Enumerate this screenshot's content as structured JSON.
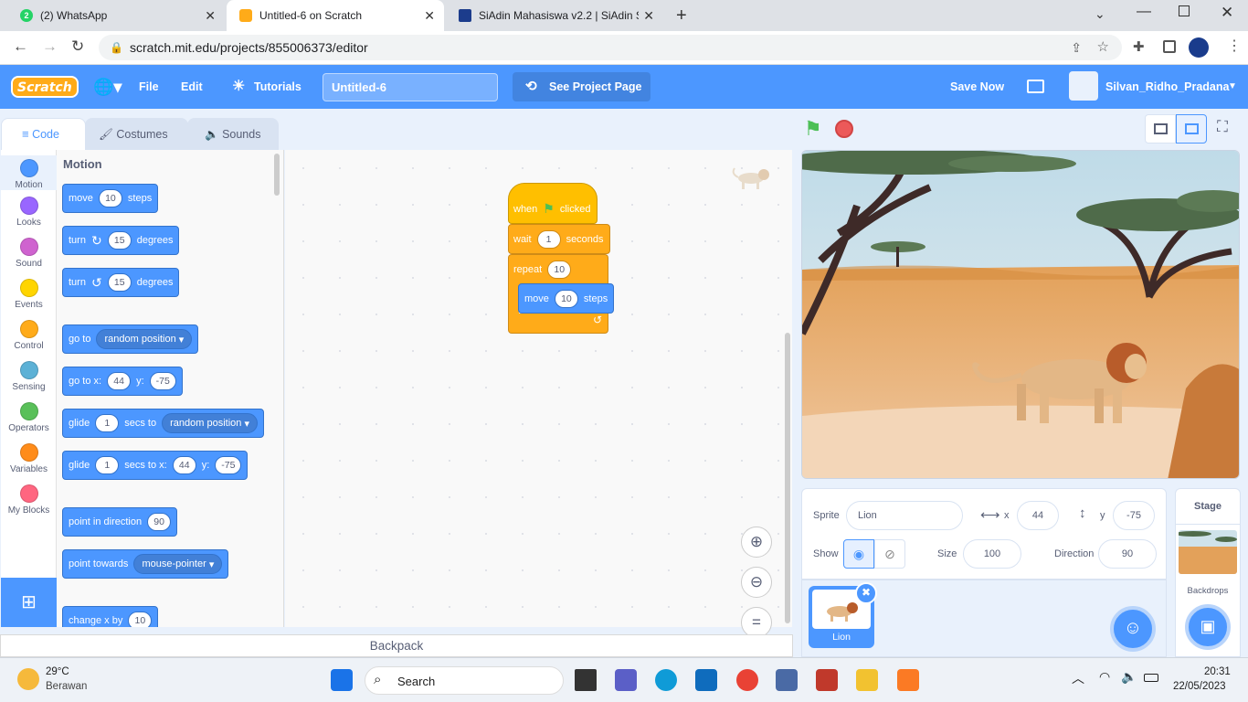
{
  "browser": {
    "tabs": [
      {
        "title": "(2) WhatsApp",
        "favicon": "whatsapp-icon",
        "favicon_text": "2"
      },
      {
        "title": "Untitled-6 on Scratch",
        "favicon": "scratch-icon"
      },
      {
        "title": "SiAdin Mahasiswa v2.2 | SiAdin S",
        "favicon": "siadin-icon"
      }
    ],
    "url": "scratch.mit.edu/projects/855006373/editor"
  },
  "menubar": {
    "logo": "Scratch",
    "file": "File",
    "edit": "Edit",
    "tutorials": "Tutorials",
    "project_title": "Untitled-6",
    "see_project": "See Project Page",
    "save_now": "Save Now",
    "username": "Silvan_Ridho_Pradana"
  },
  "editor_tabs": {
    "code": "Code",
    "costumes": "Costumes",
    "sounds": "Sounds"
  },
  "categories": [
    {
      "label": "Motion",
      "color": "#4c97ff"
    },
    {
      "label": "Looks",
      "color": "#9966ff"
    },
    {
      "label": "Sound",
      "color": "#cf63cf"
    },
    {
      "label": "Events",
      "color": "#ffd500"
    },
    {
      "label": "Control",
      "color": "#ffab19"
    },
    {
      "label": "Sensing",
      "color": "#5cb1d6"
    },
    {
      "label": "Operators",
      "color": "#59c059"
    },
    {
      "label": "Variables",
      "color": "#ff8c1a"
    },
    {
      "label": "My Blocks",
      "color": "#ff6680"
    }
  ],
  "palette": {
    "heading": "Motion",
    "move": {
      "a": "move",
      "n": "10",
      "b": "steps"
    },
    "turn_right": {
      "a": "turn",
      "n": "15",
      "b": "degrees"
    },
    "turn_left": {
      "a": "turn",
      "n": "15",
      "b": "degrees"
    },
    "goto": {
      "a": "go to",
      "d": "random position"
    },
    "gotoxy": {
      "a": "go to x:",
      "x": "44",
      "y_label": "y:",
      "y": "-75"
    },
    "glide": {
      "a": "glide",
      "n": "1",
      "b": "secs to",
      "d": "random position"
    },
    "glidexy": {
      "a": "glide",
      "n": "1",
      "b": "secs to x:",
      "x": "44",
      "y_label": "y:",
      "y": "-75"
    },
    "point_dir": {
      "a": "point in direction",
      "n": "90"
    },
    "point_towards": {
      "a": "point towards",
      "d": "mouse-pointer"
    },
    "change_x": {
      "a": "change x by",
      "n": "10"
    }
  },
  "script": {
    "when": "when",
    "clicked": "clicked",
    "wait": "wait",
    "wait_n": "1",
    "seconds": "seconds",
    "repeat": "repeat",
    "repeat_n": "10",
    "move": "move",
    "move_n": "10",
    "steps": "steps"
  },
  "backpack": "Backpack",
  "sprite_info": {
    "sprite_label": "Sprite",
    "sprite_name": "Lion",
    "x_label": "x",
    "x": "44",
    "y_label": "y",
    "y": "-75",
    "show_label": "Show",
    "size_label": "Size",
    "size": "100",
    "direction_label": "Direction",
    "direction": "90"
  },
  "sprite_list": [
    {
      "name": "Lion"
    }
  ],
  "stage_panel": {
    "title": "Stage",
    "backdrops": "Backdrops"
  },
  "taskbar": {
    "temp": "29°C",
    "weather": "Berawan",
    "search": "Search",
    "time": "20:31",
    "date": "22/05/2023"
  }
}
